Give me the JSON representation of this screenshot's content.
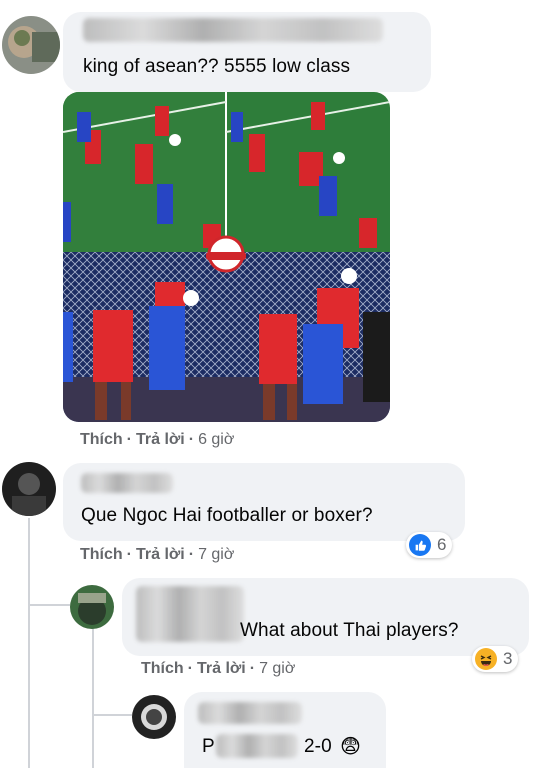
{
  "comments": [
    {
      "text": "king of asean?? 5555 low class",
      "actions": {
        "like": "Thích",
        "reply": "Trả lời",
        "time": "6 giờ"
      }
    },
    {
      "text": "Que Ngoc Hai footballer or boxer?",
      "actions": {
        "like": "Thích",
        "reply": "Trả lời",
        "time": "7 giờ"
      },
      "reaction": {
        "icon": "like-icon",
        "count": "6",
        "color": "#1877f2"
      }
    },
    {
      "text": "What about Thai players?",
      "actions": {
        "like": "Thích",
        "reply": "Trả lời",
        "time": "7 giờ"
      },
      "reaction": {
        "icon": "haha-icon",
        "count": "3",
        "color": "#f7b125"
      }
    },
    {
      "prefix": "P",
      "text": "2-0",
      "emoji": "😨"
    }
  ],
  "photo": {
    "alt_icon": "soccer-photo"
  },
  "colors": {
    "bubble": "#f0f2f5",
    "secondary_text": "#65676b",
    "like_blue": "#1877f2"
  }
}
